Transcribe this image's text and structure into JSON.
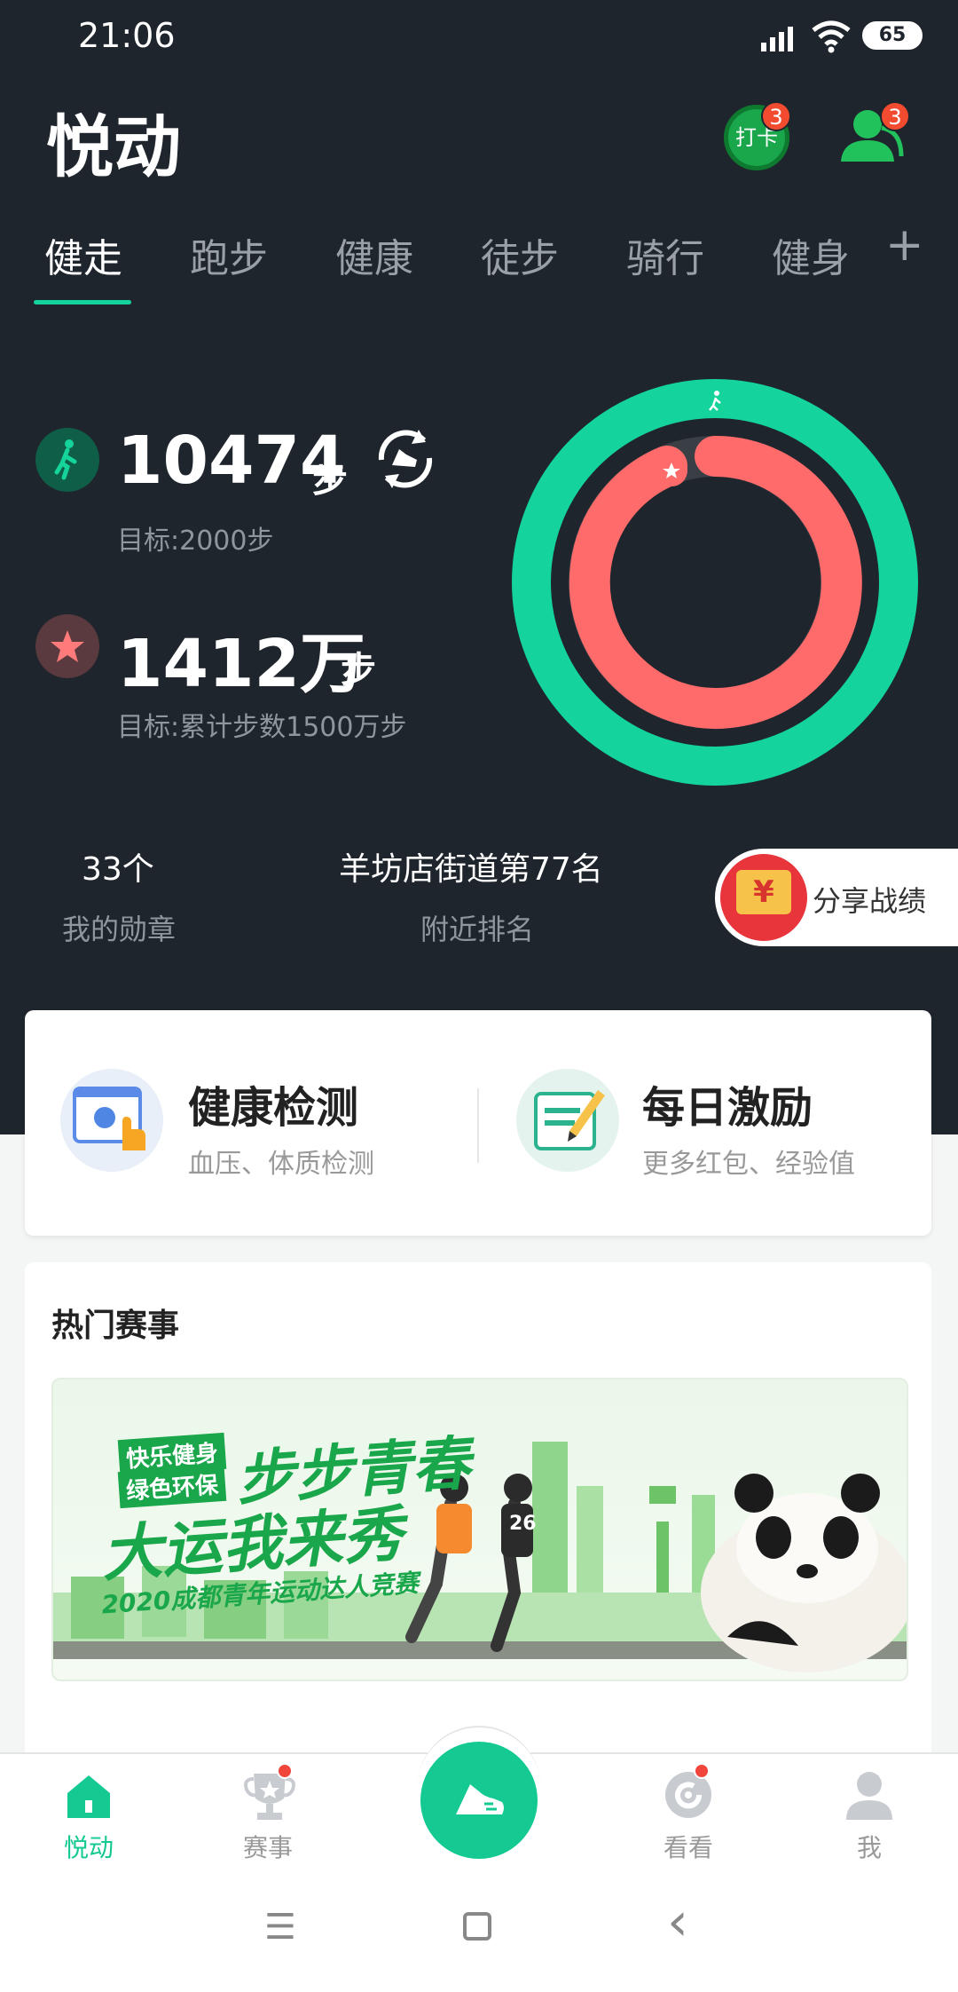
{
  "status": {
    "time": "21:06",
    "battery": "65"
  },
  "header": {
    "title": "悦动",
    "checkin_label": "打卡",
    "checkin_badge": "3",
    "friends_badge": "3"
  },
  "tabs": [
    {
      "label": "健走"
    },
    {
      "label": "跑步"
    },
    {
      "label": "健康"
    },
    {
      "label": "徒步"
    },
    {
      "label": "骑行"
    },
    {
      "label": "健身"
    }
  ],
  "add_tab": "+",
  "stats": {
    "steps_value": "10474",
    "steps_unit": "步",
    "steps_goal": "目标:2000步",
    "total_value": "1412万",
    "total_unit": "步",
    "total_goal": "目标:累计步数1500万步",
    "ring_colors": {
      "outer": "#14d39b",
      "inner": "#ff6a6a"
    }
  },
  "info_row": {
    "medals_value": "33个",
    "medals_label": "我的勋章",
    "rank_value": "羊坊店街道第77名",
    "rank_label": "附近排名",
    "share_label": "分享战绩",
    "share_icon": "¥"
  },
  "quick_cards": [
    {
      "title": "健康检测",
      "subtitle": "血压、体质检测"
    },
    {
      "title": "每日激励",
      "subtitle": "更多红包、经验值"
    }
  ],
  "events": {
    "section_title": "热门赛事",
    "banner": {
      "tag1": "快乐健身",
      "tag2": "绿色环保",
      "headline1": "步步青春",
      "headline2": "大运我来秀",
      "subtitle": "2020成都青年运动达人竞赛",
      "jersey": "26"
    }
  },
  "bottom_nav": [
    {
      "label": "悦动",
      "icon": "home-icon",
      "active": true
    },
    {
      "label": "赛事",
      "icon": "trophy-icon"
    },
    {
      "label": "",
      "icon": "shoe-icon"
    },
    {
      "label": "看看",
      "icon": "refresh-icon"
    },
    {
      "label": "我",
      "icon": "person-icon"
    }
  ],
  "system_nav": {
    "menu": "☰",
    "home": "▢",
    "back": "‹"
  }
}
